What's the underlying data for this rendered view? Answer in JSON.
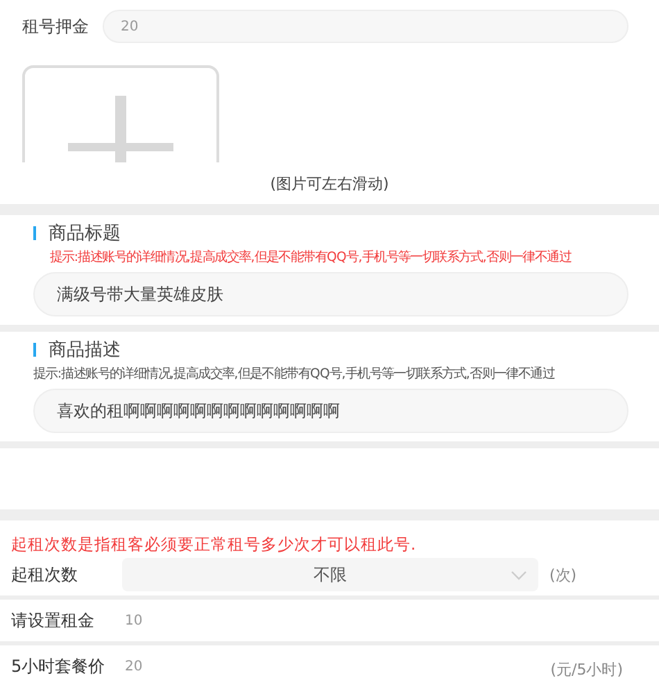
{
  "deposit": {
    "label": "租号押金",
    "placeholder": "20"
  },
  "images": {
    "caption": "(图片可左右滑动)"
  },
  "title_section": {
    "heading": "商品标题",
    "hint": "提示:描述账号的详细情况,提高成交率,但是不能带有QQ号,手机号等一切联系方式,否则一律不通过",
    "warning": true,
    "value": "满级号带大量英雄皮肤"
  },
  "description_section": {
    "heading": "商品描述",
    "hint": "提示:描述账号的详细情况,提高成交率,但是不能带有QQ号,手机号等一切联系方式,否则一律不通过",
    "warning": false,
    "value": "喜欢的租啊啊啊啊啊啊啊啊啊啊啊啊啊"
  },
  "min_rentals": {
    "note": "起租次数是指租客必须要正常租号多少次才可以租此号.",
    "label": "起租次数",
    "value": "不限",
    "unit": "(次)"
  },
  "rent": {
    "label": "请设置租金",
    "placeholder": "10"
  },
  "package": {
    "label": "5小时套餐价",
    "placeholder": "20",
    "unit": "(元/5小时)"
  }
}
